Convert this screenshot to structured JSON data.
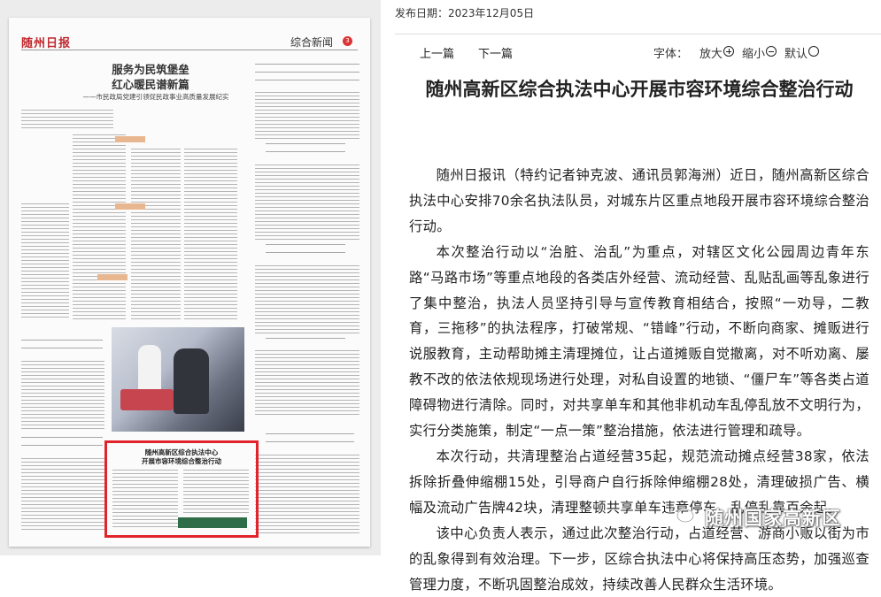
{
  "newspaper": {
    "masthead": "随州日报",
    "section": "综合新闻",
    "page_number": "3",
    "headline": "服务为民筑堡垒\n红心暖民谱新篇",
    "subheadline": "——市民政局党建引领促民政事业高质量发展纪实",
    "highlighted_title": "随州高新区综合执法中心\n开展市容环境综合整治行动"
  },
  "article": {
    "publish_date_label": "发布日期：2023年12月05日",
    "nav": {
      "prev": "上一篇",
      "next": "下一篇"
    },
    "font_controls": {
      "label": "字体：",
      "enlarge": "放大",
      "shrink": "缩小",
      "default": "默认"
    },
    "title": "随州高新区综合执法中心开展市容环境综合整治行动",
    "paragraphs": [
      "随州日报讯（特约记者钟克波、通讯员郭海洲）近日，随州高新区综合执法中心安排70余名执法队员，对城东片区重点地段开展市容环境综合整治行动。",
      "本次整治行动以“治脏、治乱”为重点，对辖区文化公园周边青年东路“马路市场”等重点地段的各类店外经营、流动经营、乱贴乱画等乱象进行了集中整治，执法人员坚持引导与宣传教育相结合，按照“一劝导，二教育，三拖移”的执法程序，打破常规、“错峰”行动，不断向商家、摊贩进行说服教育，主动帮助摊主清理摊位，让占道摊贩自觉撤离，对不听劝离、屡教不改的依法依规现场进行处理，对私自设置的地锁、“僵尸车”等各类占道障碍物进行清除。同时，对共享单车和其他非机动车乱停乱放不文明行为，实行分类施策，制定“一点一策”整治措施，依法进行管理和疏导。",
      "本次行动，共清理整治占道经营35起，规范流动摊点经营38家，依法拆除折叠伸缩棚15处，引导商户自行拆除伸缩棚28处，清理破损广告、横幅及流动广告牌42块，清理整顿共享单车违章停车、乱停乱靠百余起。",
      "该中心负责人表示，通过此次整治行动，占道经营、游商小贩以街为市的乱象得到有效治理。下一步，区综合执法中心将保持高压态势，加强巡查管理力度，不断巩固整治成效，持续改善人民群众生活环境。"
    ]
  },
  "watermark": {
    "text": "随州国家高新区",
    "icon": "wechat-icon"
  },
  "colors": {
    "highlight_border": "#e0242b",
    "masthead": "#c0282d"
  }
}
